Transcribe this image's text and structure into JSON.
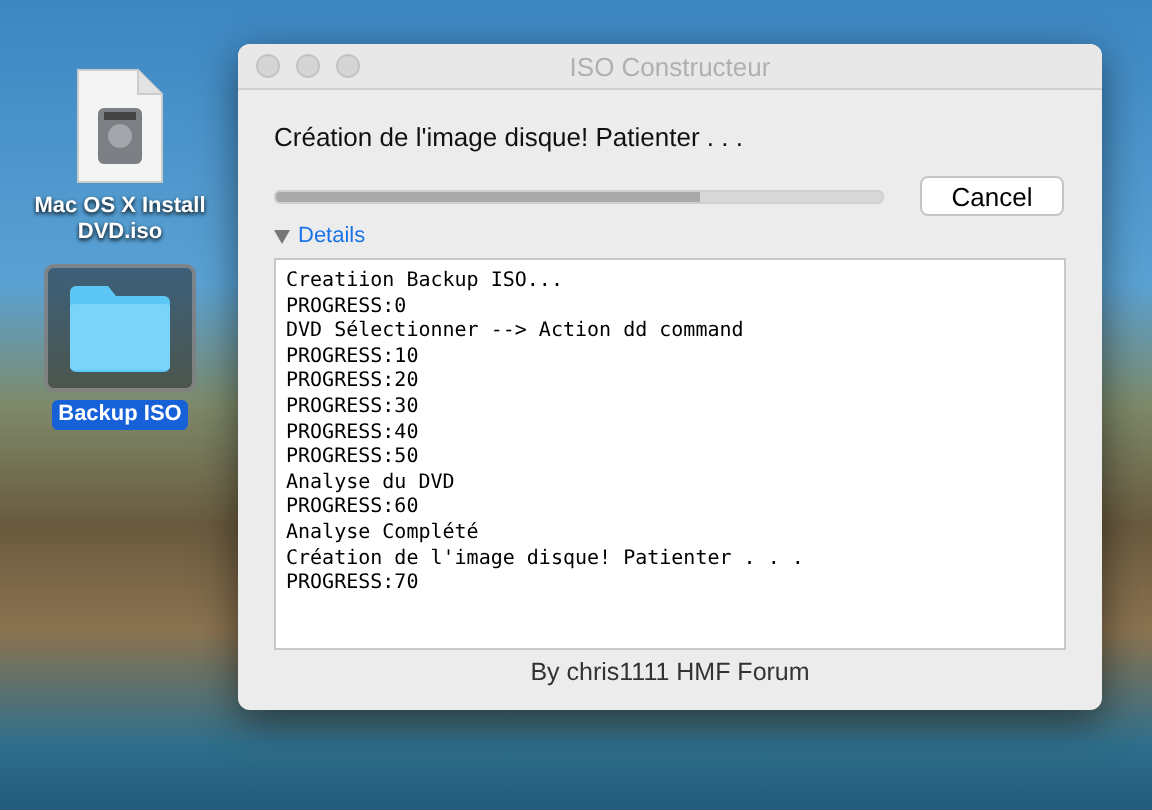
{
  "desktop": {
    "icons": [
      {
        "kind": "file",
        "label": "Mac OS X Install DVD.iso",
        "selected": false
      },
      {
        "kind": "folder",
        "label": "Backup ISO",
        "selected": true
      }
    ]
  },
  "window": {
    "title": "ISO Constructeur",
    "message": "Création de l'image disque! Patienter . . .",
    "progress": {
      "level": 0.7
    },
    "cancel": "Cancel",
    "details": {
      "label": "Details",
      "expanded": true
    },
    "log": [
      "Creatiion Backup ISO...",
      "PROGRESS:0",
      "DVD Sélectionner --> Action dd command",
      "PROGRESS:10",
      "PROGRESS:20",
      "PROGRESS:30",
      "PROGRESS:40",
      "PROGRESS:50",
      "Analyse du DVD",
      "PROGRESS:60",
      "Analyse Complété",
      "Création de l'image disque! Patienter . . .",
      "PROGRESS:70"
    ],
    "footer": "By chris1111 HMF Forum"
  }
}
